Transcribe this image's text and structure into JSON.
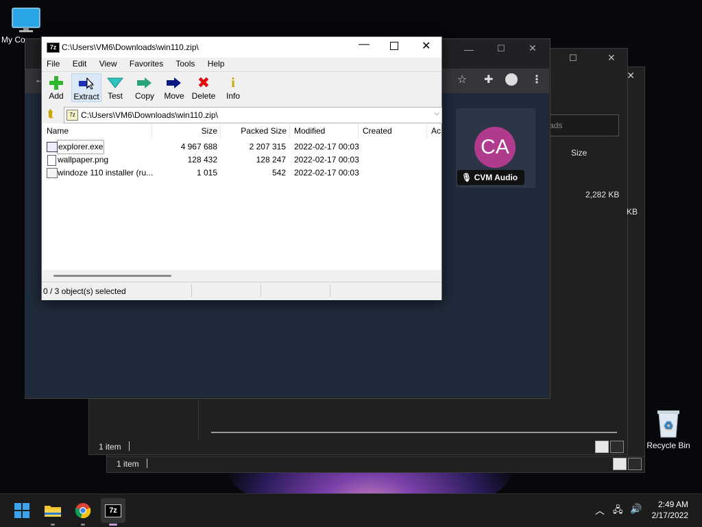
{
  "desktop": {
    "icons": [
      {
        "label": "My Co"
      },
      {
        "label": "Recycle Bin"
      }
    ]
  },
  "explorer_back": {
    "status": "1 item"
  },
  "explorer_mid": {
    "search_placeholder": "nloads",
    "col_size": "Size",
    "file_size": "2,282 KB",
    "file_size_partial": "KB",
    "status": "1 item"
  },
  "chrome": {
    "avatar_initials": "CA",
    "avatar_color": "#b03a8c",
    "avatar_label": "CVM Audio"
  },
  "sevenzip": {
    "title": "C:\\Users\\VM6\\Downloads\\win110.zip\\",
    "menu": [
      "File",
      "Edit",
      "View",
      "Favorites",
      "Tools",
      "Help"
    ],
    "toolbar": {
      "add": "Add",
      "extract": "Extract",
      "test": "Test",
      "copy": "Copy",
      "move": "Move",
      "delete": "Delete",
      "info": "Info"
    },
    "address": "C:\\Users\\VM6\\Downloads\\win110.zip\\",
    "columns": [
      "Name",
      "Size",
      "Packed Size",
      "Modified",
      "Created",
      "Ac"
    ],
    "files": [
      {
        "name": "explorer.exe",
        "size": "4 967 688",
        "packed": "2 207 315",
        "modified": "2022-02-17 00:03",
        "icon": "exe-file-icon"
      },
      {
        "name": "wallpaper.png",
        "size": "128 432",
        "packed": "128 247",
        "modified": "2022-02-17 00:03",
        "icon": "image-file-icon"
      },
      {
        "name": "windoze 110 installer (ru...",
        "size": "1 015",
        "packed": "542",
        "modified": "2022-02-17 00:03",
        "icon": "script-file-icon"
      }
    ],
    "status": "0 / 3 object(s) selected"
  },
  "taskbar": {
    "time": "2:49 AM",
    "date": "2/17/2022",
    "apps": [
      "start-button",
      "file-explorer",
      "chrome",
      "7zip"
    ]
  }
}
